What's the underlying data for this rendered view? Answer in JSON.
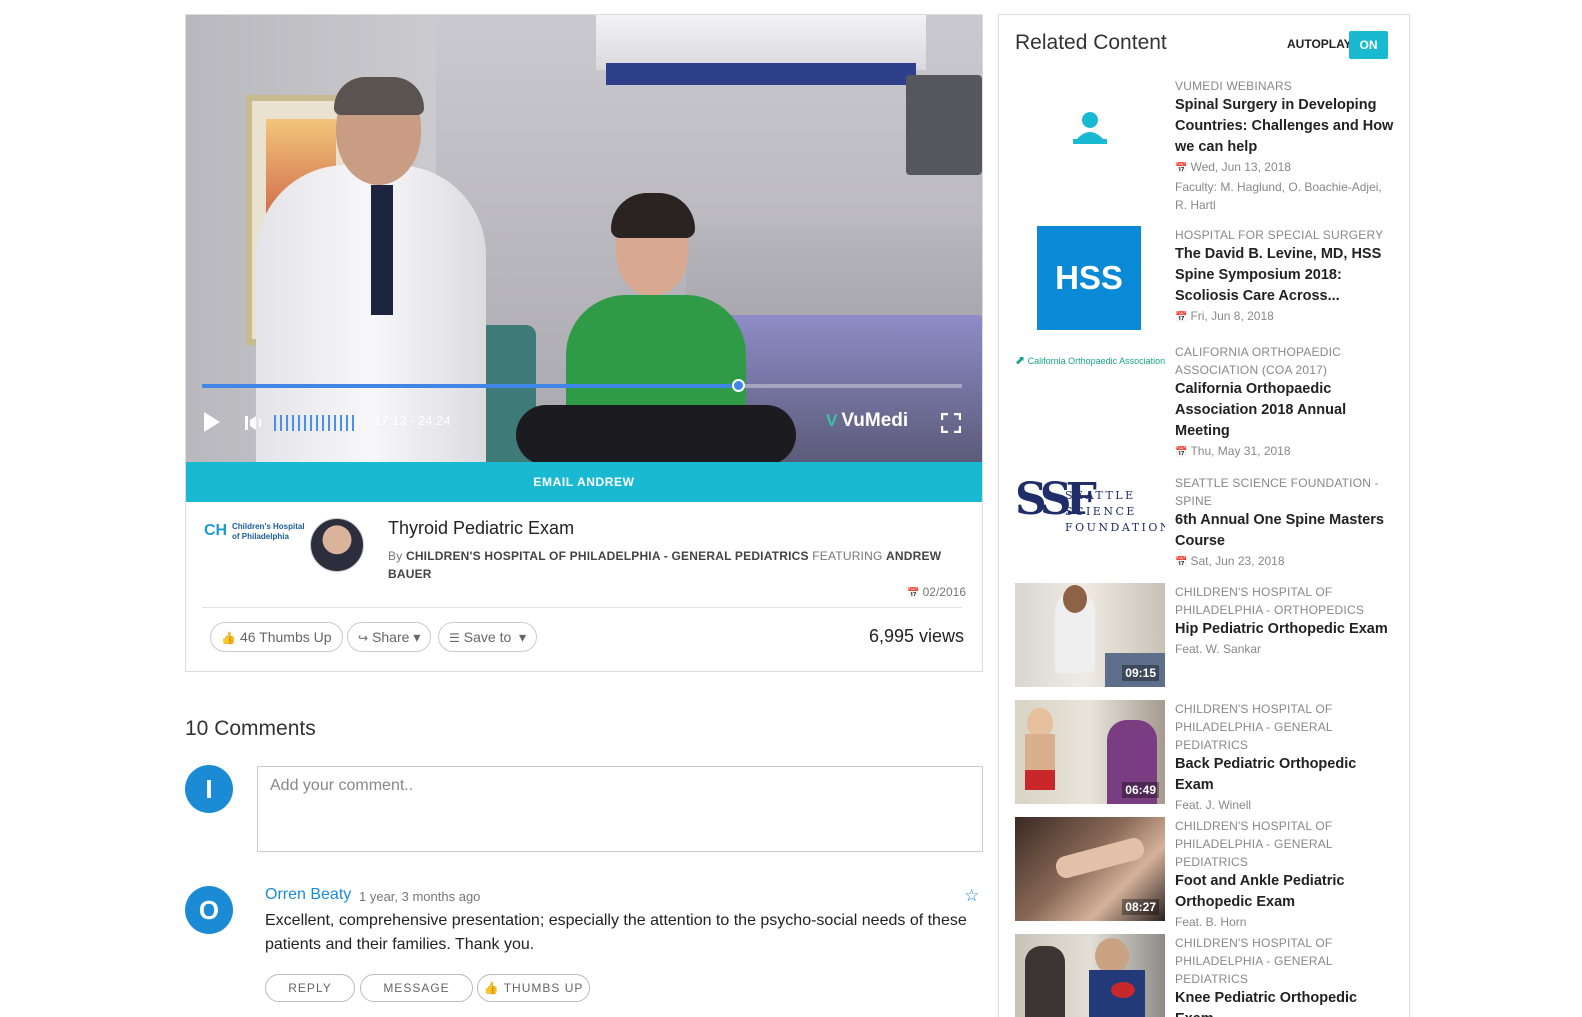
{
  "player": {
    "time": "17:13 - 24:24",
    "progress_fraction": 0.705,
    "brand": "VuMedi",
    "email_label": "EMAIL ANDREW"
  },
  "video": {
    "org_logo_text": "Children's Hospital of Philadelphia",
    "title": "Thyroid Pediatric Exam",
    "by_prefix": "By",
    "channel": "CHILDREN'S HOSPITAL OF PHILADELPHIA - GENERAL PEDIATRICS",
    "featuring_label": "FEATURING",
    "presenter": "ANDREW BAUER",
    "date": "02/2016",
    "thumbs_up": "46 Thumbs Up",
    "share": "Share",
    "save_to": "Save to",
    "views": "6,995 views"
  },
  "comments": {
    "title": "10 Comments",
    "current_user_initial": "I",
    "input_placeholder": "Add your comment..",
    "items": [
      {
        "initial": "O",
        "author": "Orren Beaty",
        "time": "1 year, 3 months ago",
        "text": "Excellent, comprehensive presentation; especially the attention to the psycho-social needs of these patients and their families. Thank you.",
        "reply": "REPLY",
        "message": "MESSAGE",
        "thumbs": "THUMBS UP"
      }
    ]
  },
  "sidebar": {
    "title": "Related Content",
    "autoplay_label": "AUTOPLAY",
    "autoplay_state": "ON",
    "items": [
      {
        "source": "VUMEDI WEBINARS",
        "title": "Spinal Surgery in Developing Countries: Challenges and How we can help",
        "date": "Wed, Jun 13, 2018",
        "meta": "Faculty: M. Haglund, O. Boachie-Adjei, R. Hartl"
      },
      {
        "source": "HOSPITAL FOR SPECIAL SURGERY",
        "title": "The David B. Levine, MD, HSS Spine Symposium 2018: Scoliosis Care Across...",
        "date": "Fri, Jun 8, 2018",
        "logo": "HSS"
      },
      {
        "source": "CALIFORNIA ORTHOPAEDIC ASSOCIATION (COA 2017)",
        "title": "California Orthopaedic Association 2018 Annual Meeting",
        "date": "Thu, May 31, 2018",
        "logo": "California Orthopaedic Association"
      },
      {
        "source": "SEATTLE SCIENCE FOUNDATION - SPINE",
        "title": "6th Annual One Spine Masters Course",
        "date": "Sat, Jun 23, 2018",
        "logo_mark": "SSF",
        "logo_lines": [
          "SEATTLE",
          "SCIENCE",
          "FOUNDATION"
        ]
      },
      {
        "source": "CHILDREN'S HOSPITAL OF PHILADELPHIA - ORTHOPEDICS",
        "title": "Hip Pediatric Orthopedic Exam",
        "meta": "Feat. W. Sankar",
        "duration": "09:15"
      },
      {
        "source": "CHILDREN'S HOSPITAL OF PHILADELPHIA - GENERAL PEDIATRICS",
        "title": "Back Pediatric Orthopedic Exam",
        "meta": "Feat. J. Winell",
        "duration": "06:49"
      },
      {
        "source": "CHILDREN'S HOSPITAL OF PHILADELPHIA - GENERAL PEDIATRICS",
        "title": "Foot and Ankle Pediatric Orthopedic Exam",
        "meta": "Feat. B. Horn",
        "duration": "08:27"
      },
      {
        "source": "CHILDREN'S HOSPITAL OF PHILADELPHIA - GENERAL PEDIATRICS",
        "title": "Knee Pediatric Orthopedic Exam"
      }
    ]
  },
  "icons": {
    "play": "play-icon",
    "volume": "volume-icon",
    "fullscreen": "fullscreen-icon",
    "calendar": "calendar-icon",
    "thumbs_up": "thumbs-up-icon",
    "share": "share-icon",
    "list": "list-icon",
    "star": "star-icon",
    "webinar": "webinar-icon"
  },
  "colors": {
    "accent": "#19b9d2",
    "link": "#1c8bd6",
    "progress": "#3f86e6"
  }
}
